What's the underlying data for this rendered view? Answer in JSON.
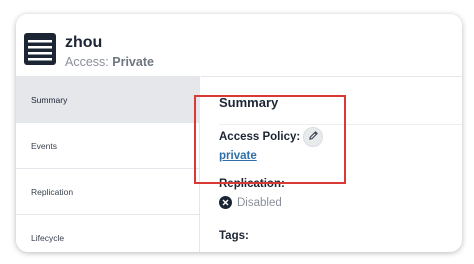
{
  "bucket": {
    "name": "zhou",
    "access_label": "Access:",
    "access_value": "Private"
  },
  "sidebar": {
    "items": [
      {
        "label": "Summary",
        "active": true
      },
      {
        "label": "Events",
        "active": false
      },
      {
        "label": "Replication",
        "active": false
      },
      {
        "label": "Lifecycle",
        "active": false
      }
    ]
  },
  "summary": {
    "title": "Summary",
    "access_policy_label": "Access Policy:",
    "access_policy_value": "private",
    "replication_label": "Replication:",
    "replication_status": "Disabled",
    "tags_label": "Tags:"
  },
  "icons": {
    "bucket": "bucket-icon",
    "edit": "pencil-icon",
    "status": "close-circle-icon"
  },
  "colors": {
    "highlight": "#d93a35",
    "link": "#2e6fa7",
    "navy": "#1b2533"
  }
}
